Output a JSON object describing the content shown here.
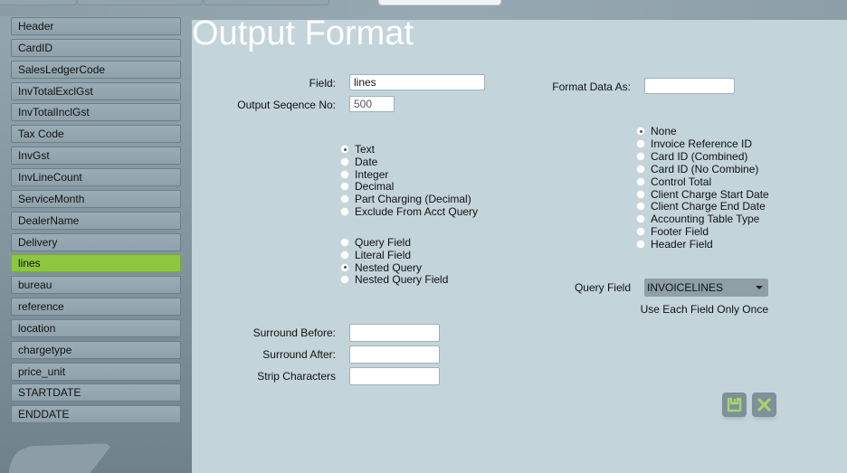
{
  "tabs": [
    {
      "label": ""
    },
    {
      "label": ""
    },
    {
      "label": ""
    },
    {
      "label": "",
      "active": true
    }
  ],
  "sidebar": {
    "items": [
      {
        "label": "Header"
      },
      {
        "label": "CardID"
      },
      {
        "label": "SalesLedgerCode"
      },
      {
        "label": "InvTotalExclGst"
      },
      {
        "label": "InvTotalInclGst"
      },
      {
        "label": "Tax Code"
      },
      {
        "label": "InvGst"
      },
      {
        "label": "InvLineCount"
      },
      {
        "label": "ServiceMonth"
      },
      {
        "label": "DealerName"
      },
      {
        "label": "Delivery"
      },
      {
        "label": "lines",
        "active": true
      },
      {
        "label": "bureau"
      },
      {
        "label": "reference"
      },
      {
        "label": "location"
      },
      {
        "label": "chargetype"
      },
      {
        "label": "price_unit"
      },
      {
        "label": "STARTDATE"
      },
      {
        "label": "ENDDATE"
      }
    ]
  },
  "main": {
    "title": "Output Format",
    "field_label": "Field:",
    "field_value": "lines",
    "sequence_label": "Output Seqence No:",
    "sequence_value": "500",
    "format_label": "Format Data As:",
    "format_value": "",
    "data_types": [
      {
        "label": "Text",
        "checked": true
      },
      {
        "label": "Date"
      },
      {
        "label": "Integer"
      },
      {
        "label": "Decimal"
      },
      {
        "label": "Part Charging (Decimal)"
      },
      {
        "label": "Exclude From Acct Query"
      }
    ],
    "source_types": [
      {
        "label": "Query Field"
      },
      {
        "label": "Literal Field"
      },
      {
        "label": "Nested Query",
        "checked": true
      },
      {
        "label": "Nested Query Field"
      }
    ],
    "special_types": [
      {
        "label": "None",
        "checked": true
      },
      {
        "label": "Invoice Reference ID"
      },
      {
        "label": "Card ID (Combined)"
      },
      {
        "label": "Card ID (No Combine)"
      },
      {
        "label": "Control Total"
      },
      {
        "label": "Client Charge Start Date"
      },
      {
        "label": "Client Charge End Date"
      },
      {
        "label": "Accounting Table Type"
      },
      {
        "label": "Footer Field"
      },
      {
        "label": "Header Field"
      }
    ],
    "query_field_label": "Query Field",
    "query_field_value": "INVOICELINES",
    "query_field_note": "Use Each Field Only Once",
    "surround_before_label": "Surround Before:",
    "surround_before_value": "",
    "surround_after_label": "Surround After:",
    "surround_after_value": "",
    "strip_label": "Strip Characters",
    "strip_value": "",
    "icons": {
      "save": "save-icon",
      "cancel": "close-icon"
    },
    "colors": {
      "accent": "#8dc63f",
      "panel": "#c3d4db",
      "icon_fg": "#a8d46a"
    }
  }
}
